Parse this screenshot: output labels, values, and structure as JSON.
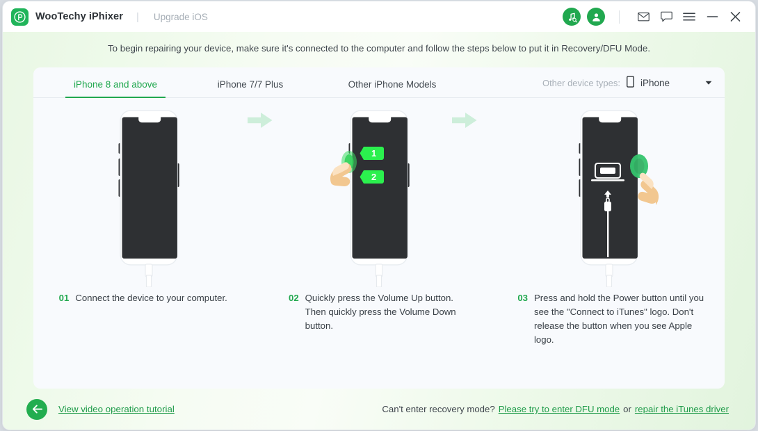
{
  "titlebar": {
    "brand_name": "WooTechy iPhixer",
    "separator": "|",
    "sub_label": "Upgrade iOS",
    "logo_icon": "wootechy-logo-icon",
    "icons": [
      {
        "name": "itunes-music-search-icon",
        "label": "iTunes"
      },
      {
        "name": "user-account-icon",
        "label": "Account"
      },
      {
        "name": "mail-icon",
        "label": "Mail"
      },
      {
        "name": "feedback-chat-icon",
        "label": "Feedback"
      },
      {
        "name": "menu-hamburger-icon",
        "label": "Menu"
      },
      {
        "name": "minimize-icon",
        "label": "Minimize"
      },
      {
        "name": "close-icon",
        "label": "Close"
      }
    ]
  },
  "intro": {
    "text": "To begin repairing your device, make sure it's connected to the computer and follow the steps below to put it in Recovery/DFU Mode."
  },
  "tabs": [
    {
      "label": "iPhone 8 and above",
      "active": true
    },
    {
      "label": "iPhone 7/7 Plus",
      "active": false
    },
    {
      "label": "Other iPhone Models",
      "active": false
    }
  ],
  "device_type": {
    "label": "Other device types:",
    "value": "iPhone",
    "icon": "phone-icon",
    "caret": "chevron-down-icon"
  },
  "steps": [
    {
      "number": "01",
      "text": "Connect the device to your computer.",
      "illustration": "iphone-connected-to-computer"
    },
    {
      "number": "02",
      "text": "Quickly press the Volume Up button. Then quickly press the Volume Down button.",
      "illustration": "iphone-volume-buttons-press",
      "badges": [
        "1",
        "2"
      ]
    },
    {
      "number": "03",
      "text": "Press and hold the Power button until you see the \"Connect to iTunes\" logo. Don't release the button when you see Apple logo.",
      "illustration": "iphone-recovery-connect-to-itunes"
    }
  ],
  "footer": {
    "back_icon": "back-arrow-icon",
    "tutorial_link": "View video operation tutorial",
    "question": "Can't enter recovery mode?",
    "dfu_link": "Please try to enter DFU mode",
    "or_text": "or",
    "driver_link": "repair the iTunes driver"
  },
  "colors": {
    "accent_green": "#21a84f",
    "link_green": "#1e9b49",
    "phone_screen": "#2e3033",
    "arrow_mint": "#cdeeda"
  }
}
